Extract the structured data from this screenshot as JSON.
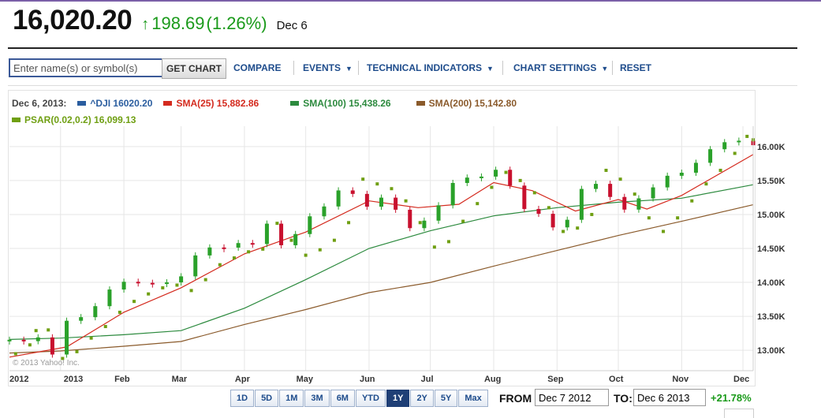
{
  "quote": {
    "price": "16,020.20",
    "arrow": "↑",
    "change": "198.69",
    "change_pct": "(1.26%)",
    "date": "Dec 6"
  },
  "toolbar": {
    "search_placeholder": "Enter name(s) or symbol(s)",
    "get_chart": "GET CHART",
    "compare": "COMPARE",
    "events": "EVENTS",
    "technical_indicators": "TECHNICAL INDICATORS",
    "chart_settings": "CHART SETTINGS",
    "reset": "RESET"
  },
  "legend": {
    "date": "Dec 6, 2013:",
    "items": [
      {
        "label": "^DJI 16020.20",
        "color": "#2a5d9f"
      },
      {
        "label": "SMA(25) 15,882.86",
        "color": "#d42a1e"
      },
      {
        "label": "SMA(100) 15,438.26",
        "color": "#2c8a3e"
      },
      {
        "label": "SMA(200) 15,142.80",
        "color": "#8a5a2b"
      },
      {
        "label": "PSAR(0.02,0.2) 16,099.13",
        "color": "#6f9f12"
      }
    ]
  },
  "copyright": "© 2013 Yahoo! Inc.",
  "ranges": [
    {
      "label": "1D",
      "selected": false
    },
    {
      "label": "5D",
      "selected": false
    },
    {
      "label": "1M",
      "selected": false
    },
    {
      "label": "3M",
      "selected": false
    },
    {
      "label": "6M",
      "selected": false
    },
    {
      "label": "YTD",
      "selected": false
    },
    {
      "label": "1Y",
      "selected": true
    },
    {
      "label": "2Y",
      "selected": false
    },
    {
      "label": "5Y",
      "selected": false
    },
    {
      "label": "Max",
      "selected": false
    }
  ],
  "date_range": {
    "from_label": "FROM",
    "from_value": "Dec 7 2012",
    "to_label": "TO:",
    "to_value": "Dec 6 2013",
    "period_change": "+21.78%"
  },
  "chart_data": {
    "type": "line",
    "title": "",
    "xlabel": "",
    "ylabel": "",
    "ylim": [
      12700,
      16300
    ],
    "xlim": [
      "2012-12-07",
      "2013-12-06"
    ],
    "grid": true,
    "y_ticks": [
      "13.00K",
      "13.50K",
      "14.00K",
      "14.50K",
      "15.00K",
      "15.50K",
      "16.00K"
    ],
    "y_tick_values": [
      13000,
      13500,
      14000,
      14500,
      15000,
      15500,
      16000
    ],
    "x_ticks": [
      {
        "label": "2012",
        "date": "2012-12-07"
      },
      {
        "label": "2013",
        "date": "2013-01-01"
      },
      {
        "label": "Feb",
        "date": "2013-02-01"
      },
      {
        "label": "Mar",
        "date": "2013-03-01"
      },
      {
        "label": "Apr",
        "date": "2013-04-01"
      },
      {
        "label": "May",
        "date": "2013-05-01"
      },
      {
        "label": "Jun",
        "date": "2013-06-01"
      },
      {
        "label": "Jul",
        "date": "2013-07-01"
      },
      {
        "label": "Aug",
        "date": "2013-08-01"
      },
      {
        "label": "Sep",
        "date": "2013-09-01"
      },
      {
        "label": "Oct",
        "date": "2013-10-01"
      },
      {
        "label": "Nov",
        "date": "2013-11-01"
      },
      {
        "label": "Dec",
        "date": "2013-12-01"
      }
    ],
    "series": [
      {
        "name": "^DJI",
        "kind": "candlestick",
        "color_up": "#2aa12a",
        "color_down": "#c8102e",
        "points": [
          [
            "2012-12-07",
            13155
          ],
          [
            "2012-12-14",
            13135
          ],
          [
            "2012-12-21",
            13190
          ],
          [
            "2012-12-28",
            12938
          ],
          [
            "2013-01-04",
            13435
          ],
          [
            "2013-01-11",
            13488
          ],
          [
            "2013-01-18",
            13650
          ],
          [
            "2013-01-25",
            13895
          ],
          [
            "2013-02-01",
            14009
          ],
          [
            "2013-02-08",
            13993
          ],
          [
            "2013-02-15",
            13981
          ],
          [
            "2013-02-22",
            14000
          ],
          [
            "2013-03-01",
            14089
          ],
          [
            "2013-03-08",
            14397
          ],
          [
            "2013-03-15",
            14514
          ],
          [
            "2013-03-22",
            14512
          ],
          [
            "2013-03-29",
            14579
          ],
          [
            "2013-04-05",
            14565
          ],
          [
            "2013-04-12",
            14865
          ],
          [
            "2013-04-19",
            14547
          ],
          [
            "2013-04-26",
            14712
          ],
          [
            "2013-05-03",
            14973
          ],
          [
            "2013-05-10",
            15118
          ],
          [
            "2013-05-17",
            15354
          ],
          [
            "2013-05-24",
            15303
          ],
          [
            "2013-05-31",
            15115
          ],
          [
            "2013-06-07",
            15248
          ],
          [
            "2013-06-14",
            15070
          ],
          [
            "2013-06-21",
            14799
          ],
          [
            "2013-06-28",
            14909
          ],
          [
            "2013-07-05",
            15135
          ],
          [
            "2013-07-12",
            15464
          ],
          [
            "2013-07-19",
            15543
          ],
          [
            "2013-07-26",
            15558
          ],
          [
            "2013-08-02",
            15658
          ],
          [
            "2013-08-09",
            15425
          ],
          [
            "2013-08-16",
            15081
          ],
          [
            "2013-08-23",
            15010
          ],
          [
            "2013-08-30",
            14810
          ],
          [
            "2013-09-06",
            14922
          ],
          [
            "2013-09-13",
            15376
          ],
          [
            "2013-09-20",
            15451
          ],
          [
            "2013-09-27",
            15258
          ],
          [
            "2013-10-04",
            15072
          ],
          [
            "2013-10-11",
            15237
          ],
          [
            "2013-10-18",
            15399
          ],
          [
            "2013-10-25",
            15570
          ],
          [
            "2013-11-01",
            15615
          ],
          [
            "2013-11-08",
            15761
          ],
          [
            "2013-11-15",
            15961
          ],
          [
            "2013-11-22",
            16064
          ],
          [
            "2013-11-29",
            16086
          ],
          [
            "2013-12-06",
            16020
          ]
        ]
      },
      {
        "name": "SMA(25)",
        "color": "#d42a1e",
        "points": [
          [
            "2012-12-07",
            12900
          ],
          [
            "2013-01-04",
            13050
          ],
          [
            "2013-02-01",
            13560
          ],
          [
            "2013-03-01",
            13920
          ],
          [
            "2013-04-01",
            14420
          ],
          [
            "2013-05-01",
            14740
          ],
          [
            "2013-06-01",
            15200
          ],
          [
            "2013-06-25",
            15100
          ],
          [
            "2013-07-15",
            15150
          ],
          [
            "2013-08-01",
            15470
          ],
          [
            "2013-08-20",
            15350
          ],
          [
            "2013-09-10",
            15050
          ],
          [
            "2013-10-01",
            15220
          ],
          [
            "2013-10-15",
            15080
          ],
          [
            "2013-11-01",
            15280
          ],
          [
            "2013-12-06",
            15883
          ]
        ]
      },
      {
        "name": "SMA(100)",
        "color": "#2c8a3e",
        "points": [
          [
            "2012-12-07",
            13160
          ],
          [
            "2013-01-01",
            13180
          ],
          [
            "2013-02-01",
            13230
          ],
          [
            "2013-03-01",
            13290
          ],
          [
            "2013-04-01",
            13620
          ],
          [
            "2013-05-01",
            14040
          ],
          [
            "2013-06-01",
            14500
          ],
          [
            "2013-07-01",
            14760
          ],
          [
            "2013-08-01",
            14980
          ],
          [
            "2013-09-01",
            15100
          ],
          [
            "2013-10-01",
            15180
          ],
          [
            "2013-11-01",
            15240
          ],
          [
            "2013-12-06",
            15438
          ]
        ]
      },
      {
        "name": "SMA(200)",
        "color": "#8a5a2b",
        "points": [
          [
            "2012-12-07",
            12960
          ],
          [
            "2013-01-01",
            12990
          ],
          [
            "2013-02-01",
            13060
          ],
          [
            "2013-03-01",
            13130
          ],
          [
            "2013-04-01",
            13380
          ],
          [
            "2013-05-01",
            13600
          ],
          [
            "2013-06-01",
            13850
          ],
          [
            "2013-07-01",
            14000
          ],
          [
            "2013-08-01",
            14240
          ],
          [
            "2013-09-01",
            14470
          ],
          [
            "2013-10-01",
            14690
          ],
          [
            "2013-11-01",
            14900
          ],
          [
            "2013-12-06",
            15143
          ]
        ]
      },
      {
        "name": "PSAR(0.02,0.2)",
        "kind": "dots",
        "color": "#6f9f12",
        "points": [
          [
            "2012-12-10",
            12950
          ],
          [
            "2012-12-17",
            13080
          ],
          [
            "2012-12-20",
            13290
          ],
          [
            "2012-12-26",
            13300
          ],
          [
            "2013-01-02",
            12880
          ],
          [
            "2013-01-09",
            12980
          ],
          [
            "2013-01-16",
            13180
          ],
          [
            "2013-01-23",
            13350
          ],
          [
            "2013-01-30",
            13560
          ],
          [
            "2013-02-06",
            13720
          ],
          [
            "2013-02-13",
            13830
          ],
          [
            "2013-02-20",
            13920
          ],
          [
            "2013-02-27",
            13960
          ],
          [
            "2013-03-06",
            13880
          ],
          [
            "2013-03-13",
            14040
          ],
          [
            "2013-03-20",
            14260
          ],
          [
            "2013-03-27",
            14360
          ],
          [
            "2013-04-03",
            14450
          ],
          [
            "2013-04-10",
            14490
          ],
          [
            "2013-04-17",
            14870
          ],
          [
            "2013-04-24",
            14620
          ],
          [
            "2013-05-01",
            14400
          ],
          [
            "2013-05-08",
            14480
          ],
          [
            "2013-05-15",
            14620
          ],
          [
            "2013-05-22",
            14880
          ],
          [
            "2013-05-29",
            15520
          ],
          [
            "2013-06-05",
            15450
          ],
          [
            "2013-06-12",
            15380
          ],
          [
            "2013-06-19",
            15200
          ],
          [
            "2013-06-26",
            14880
          ],
          [
            "2013-07-03",
            14520
          ],
          [
            "2013-07-10",
            14600
          ],
          [
            "2013-07-17",
            14900
          ],
          [
            "2013-07-24",
            15160
          ],
          [
            "2013-07-31",
            15400
          ],
          [
            "2013-08-07",
            15620
          ],
          [
            "2013-08-14",
            15500
          ],
          [
            "2013-08-21",
            15320
          ],
          [
            "2013-08-28",
            15100
          ],
          [
            "2013-09-04",
            14750
          ],
          [
            "2013-09-11",
            14800
          ],
          [
            "2013-09-18",
            15000
          ],
          [
            "2013-09-25",
            15650
          ],
          [
            "2013-10-02",
            15520
          ],
          [
            "2013-10-09",
            15300
          ],
          [
            "2013-10-16",
            14950
          ],
          [
            "2013-10-23",
            14750
          ],
          [
            "2013-10-30",
            14950
          ],
          [
            "2013-11-06",
            15200
          ],
          [
            "2013-11-13",
            15450
          ],
          [
            "2013-11-20",
            15650
          ],
          [
            "2013-11-27",
            15900
          ],
          [
            "2013-12-03",
            16150
          ],
          [
            "2013-12-06",
            16099
          ]
        ]
      }
    ]
  }
}
